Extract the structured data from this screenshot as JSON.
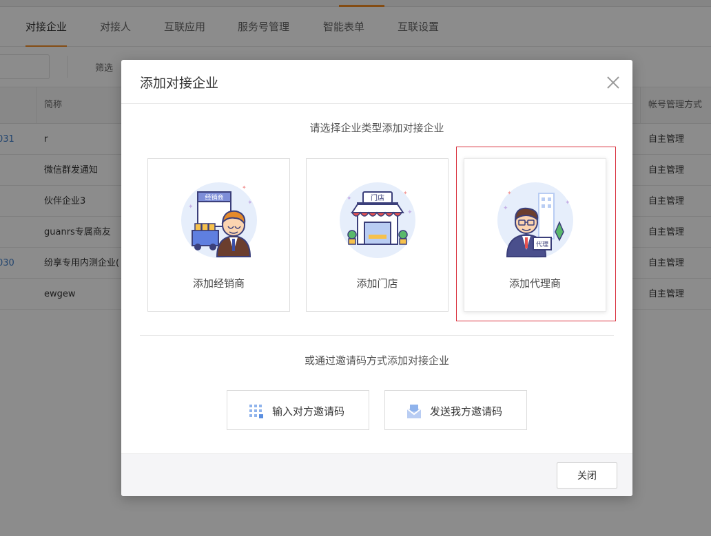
{
  "tabs": [
    {
      "label": "对接企业",
      "active": true
    },
    {
      "label": "对接人"
    },
    {
      "label": "互联应用"
    },
    {
      "label": "服务号管理"
    },
    {
      "label": "智能表单"
    },
    {
      "label": "互联设置"
    }
  ],
  "toolbar": {
    "filter_label": "筛选"
  },
  "table": {
    "headers": {
      "short_name": "简称",
      "account_mode": "帐号管理方式"
    },
    "rows": [
      {
        "id_partial": "031",
        "short_name": "r",
        "account_mode": "自主管理"
      },
      {
        "id_partial": "",
        "short_name": "微信群发通知",
        "account_mode": "自主管理"
      },
      {
        "id_partial": "",
        "short_name": "伙伴企业3",
        "account_mode": "自主管理"
      },
      {
        "id_partial": "",
        "short_name": "guanrs专属商友",
        "account_mode": "自主管理"
      },
      {
        "id_partial": "030",
        "short_name": "纷享专用内测企业(",
        "account_mode": "自主管理"
      },
      {
        "id_partial": "",
        "short_name": "ewgew",
        "account_mode": "自主管理"
      }
    ]
  },
  "modal": {
    "title": "添加对接企业",
    "subtitle": "请选择企业类型添加对接企业",
    "cards": [
      {
        "label": "添加经销商",
        "sign": "经销商",
        "icon": "distributor-icon"
      },
      {
        "label": "添加门店",
        "sign": "门店",
        "icon": "store-icon"
      },
      {
        "label": "添加代理商",
        "sign": "代理",
        "icon": "agent-icon",
        "selected": true
      }
    ],
    "invite_hint": "或通过邀请码方式添加对接企业",
    "invite_buttons": [
      {
        "label": "输入对方邀请码",
        "icon": "keypad-icon"
      },
      {
        "label": "发送我方邀请码",
        "icon": "envelope-icon"
      }
    ],
    "footer": {
      "close_label": "关闭"
    }
  },
  "colors": {
    "accent": "#f08a24",
    "selected_border": "#d9303d",
    "link": "#3f7ecb",
    "illus_bg": "#e6eefb"
  }
}
